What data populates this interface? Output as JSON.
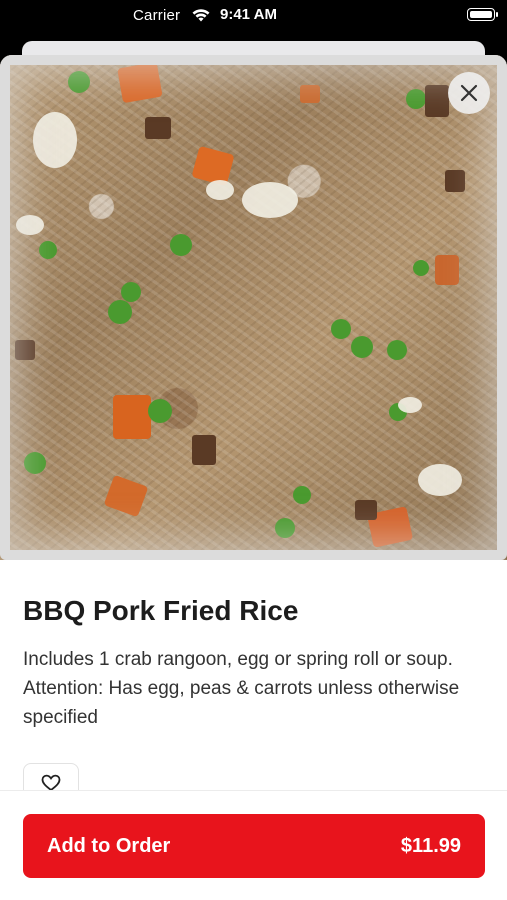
{
  "status_bar": {
    "carrier": "Carrier",
    "time": "9:41 AM"
  },
  "item": {
    "image_alt": "BBQ Pork Fried Rice",
    "title": "BBQ Pork Fried Rice",
    "description": "Includes 1 crab rangoon, egg or spring roll or soup. Attention: Has egg, peas & carrots unless otherwise specified"
  },
  "actions": {
    "add_to_order_label": "Add to Order",
    "price": "$11.99"
  },
  "colors": {
    "accent": "#e8141c"
  },
  "icons": {
    "close": "close-icon",
    "favorite": "heart-icon",
    "wifi": "wifi-icon",
    "battery": "battery-icon"
  }
}
